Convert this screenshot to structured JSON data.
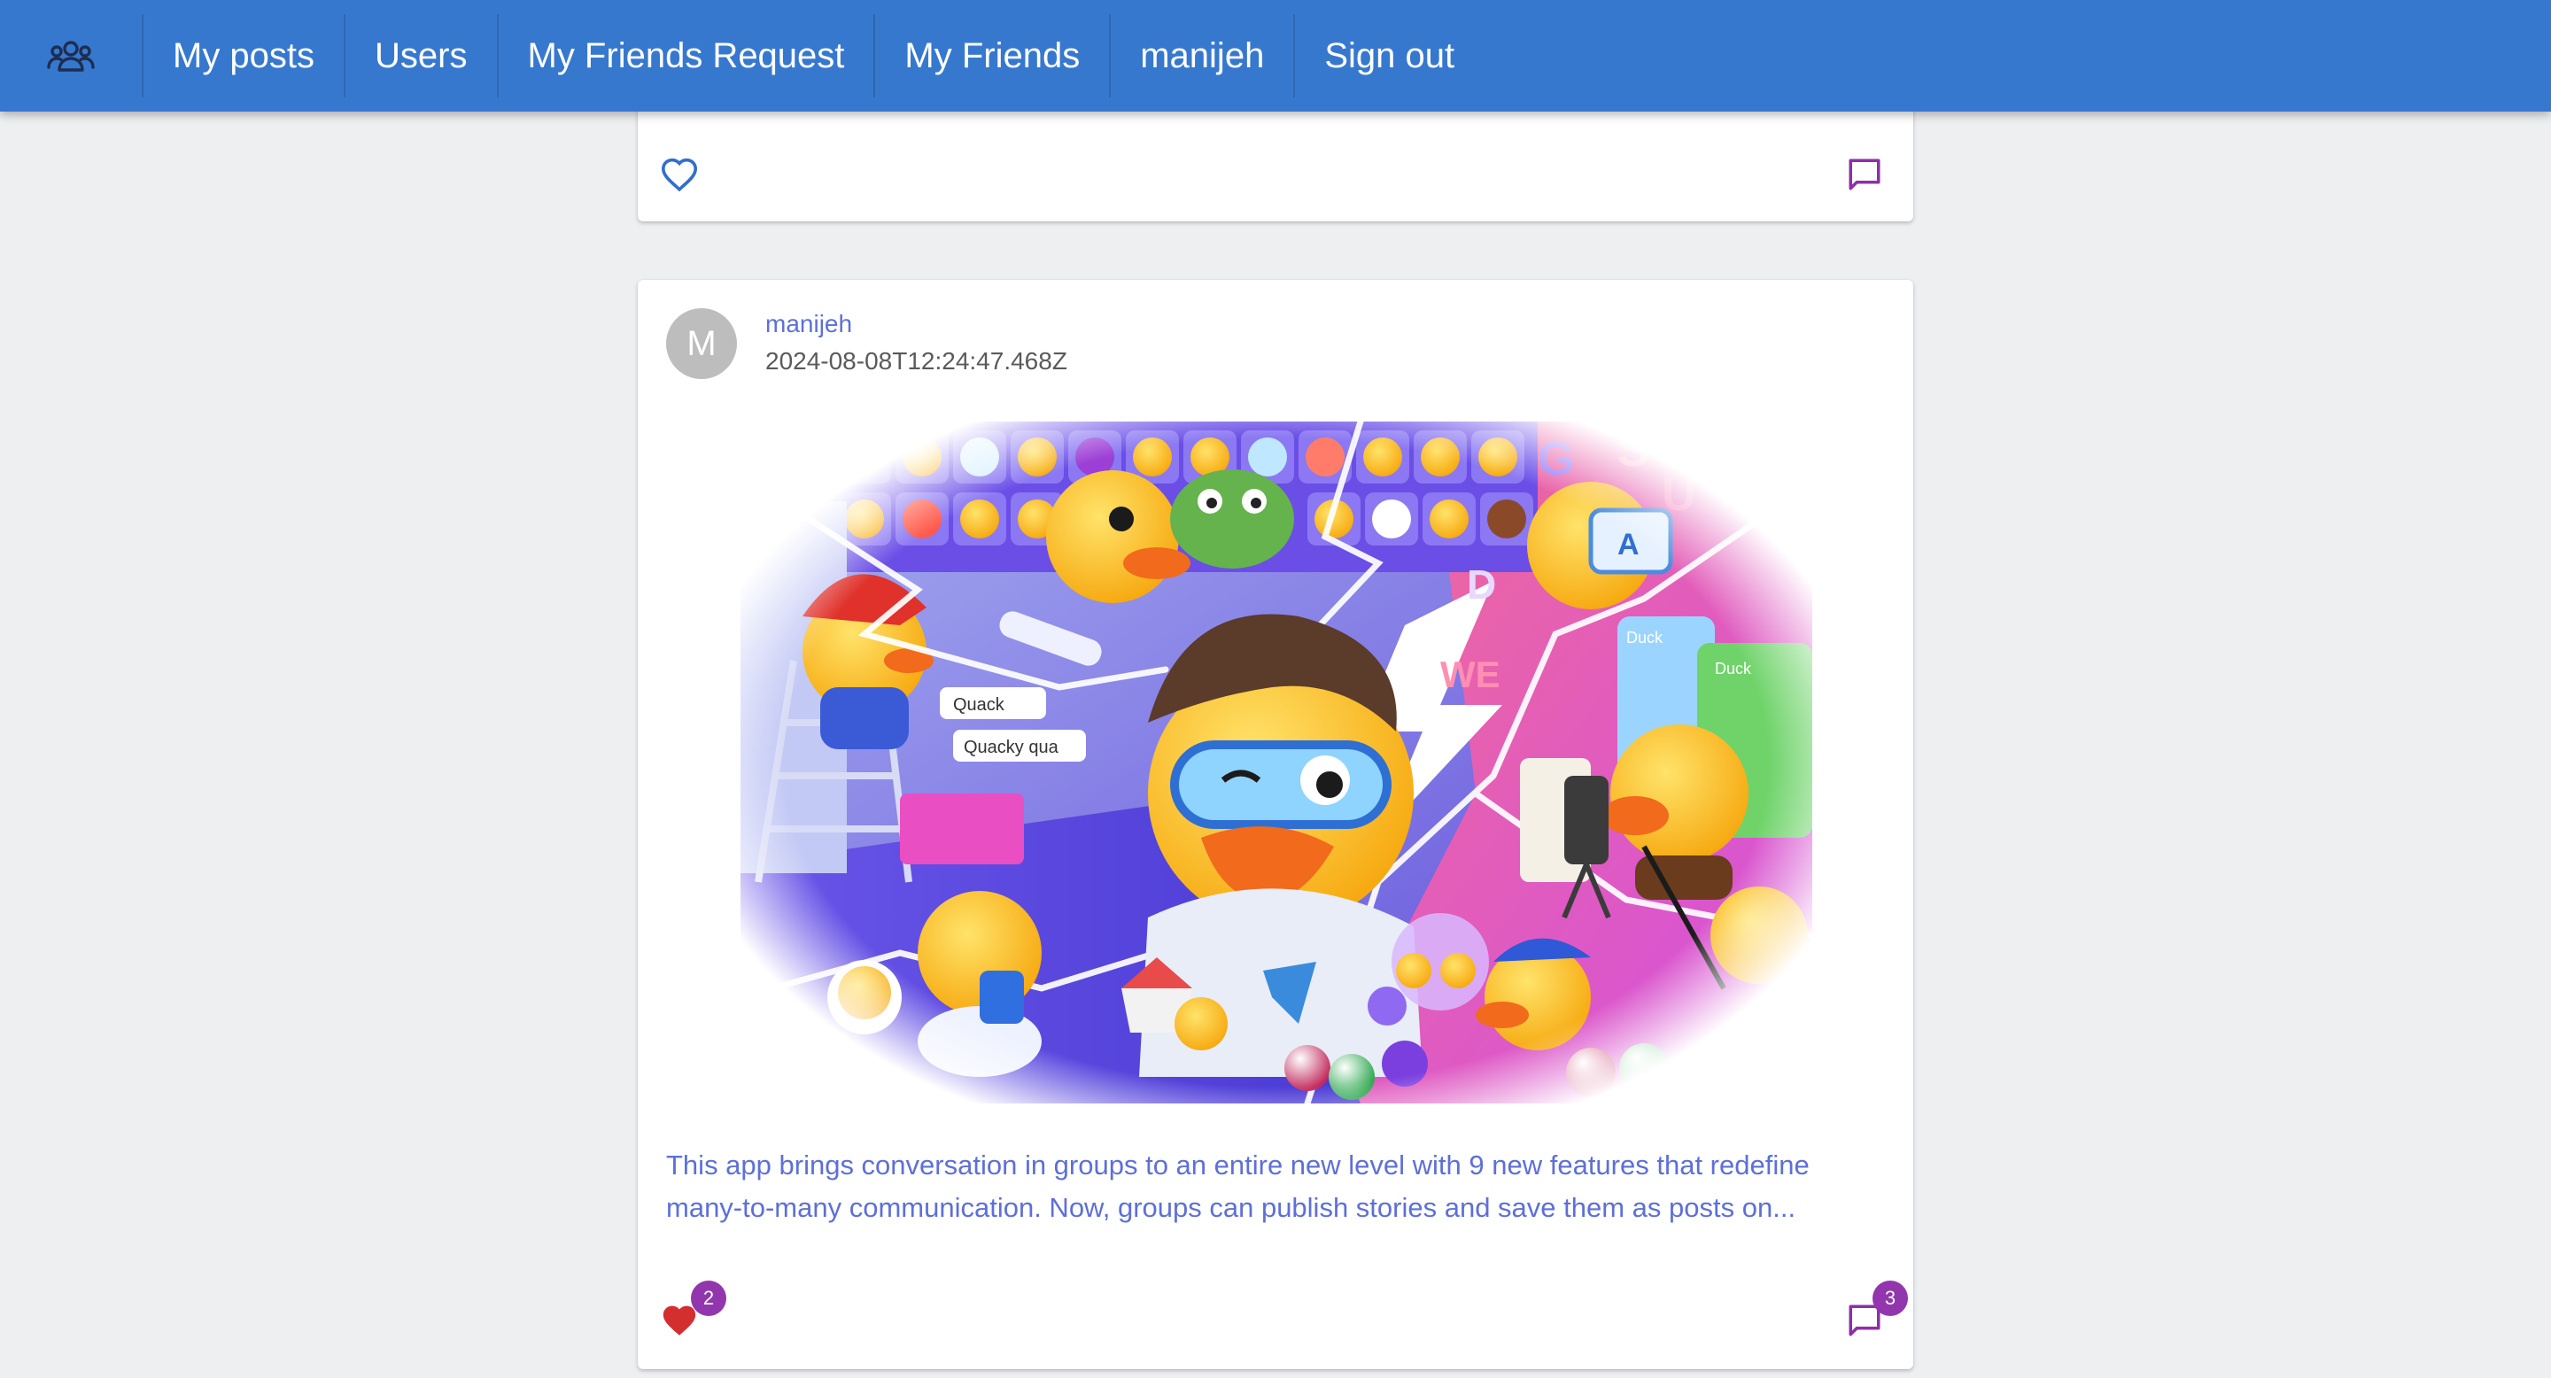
{
  "nav": {
    "logo_icon": "people-group-icon",
    "items": [
      "My posts",
      "Users",
      "My Friends Request",
      "My Friends",
      "manijeh",
      "Sign out"
    ]
  },
  "previous_post": {
    "like_icon": "heart-outline-icon",
    "comment_icon": "comment-icon"
  },
  "post": {
    "avatar_letter": "M",
    "author": "manijeh",
    "date": "2024-08-08T12:24:47.468Z",
    "image_texts": [
      "Quack",
      "Quacky qua",
      "Duck",
      "Duck",
      "A"
    ],
    "text_line1": "This app brings conversation in groups to an entire new level with 9 new features that redefine",
    "text_line2": "many-to-many communication. Now, groups can publish stories and save them as posts on...",
    "likes_count": "2",
    "comments_count": "3",
    "like_icon": "heart-filled-icon",
    "comment_icon": "comment-icon"
  },
  "colors": {
    "appbar": "#3778cf",
    "background": "#eeeff1",
    "link_text": "#5e6fd8",
    "badge": "#9236ad",
    "heart_filled": "#d32f2f",
    "heart_outline": "#2f6fcf",
    "comment_icon": "#8e2fa8"
  }
}
